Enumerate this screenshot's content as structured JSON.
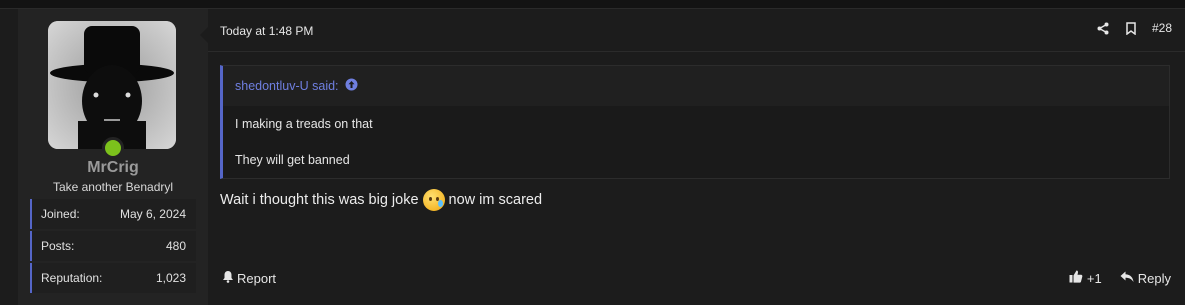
{
  "user": {
    "username": "MrCrig",
    "title": "Take another Benadryl",
    "online_color": "#7cc11c",
    "stats": [
      {
        "label": "Joined:",
        "value": "May 6, 2024"
      },
      {
        "label": "Posts:",
        "value": "480"
      },
      {
        "label": "Reputation:",
        "value": "1,023"
      }
    ]
  },
  "post": {
    "timestamp": "Today at 1:48 PM",
    "number": "#28",
    "quote": {
      "author": "shedontluv-U said:",
      "lines": [
        "I making a treads on that",
        "They will get banned"
      ]
    },
    "message_before": "Wait i thought this was big joke",
    "message_emoji": "crying-face-emoji",
    "message_after": "now im scared",
    "actions": {
      "report": "Report",
      "reaction_count": "+1",
      "reply": "Reply"
    }
  },
  "colors": {
    "accent": "#5566c8",
    "link": "#6f7fe0"
  }
}
